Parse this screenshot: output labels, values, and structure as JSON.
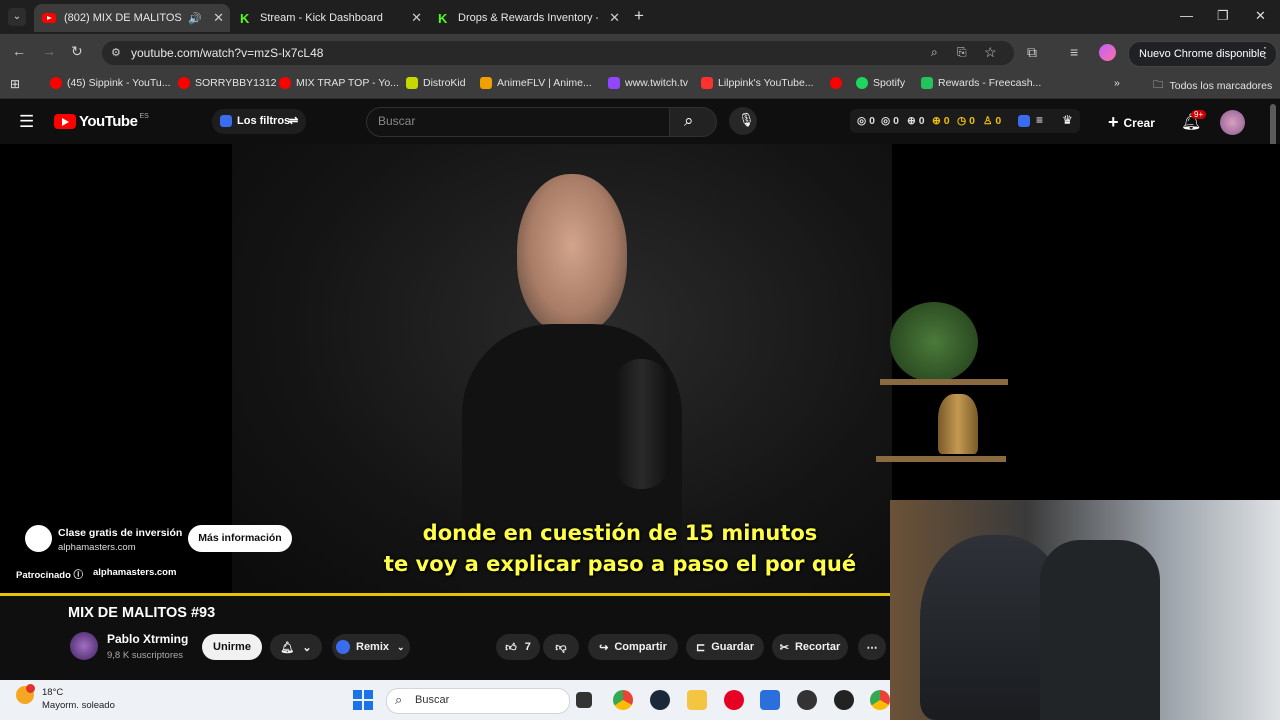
{
  "browser": {
    "tabs": [
      {
        "title": "(802) MIX DE MALITOS #93",
        "active": true,
        "favicon": "youtube-icon"
      },
      {
        "title": "Stream - Kick Dashboard",
        "active": false,
        "favicon": "kick-icon"
      },
      {
        "title": "Drops & Rewards Inventory - Ki",
        "active": false,
        "favicon": "kick-icon"
      }
    ],
    "url": "youtube.com/watch?v=mzS-lx7cL48",
    "chrome_update_label": "Nuevo Chrome disponible",
    "bookmarks": [
      {
        "label": "(45) Sippink - YouTu...",
        "color": "#ff0000"
      },
      {
        "label": "SORRYBBY1312",
        "color": "#ff0000"
      },
      {
        "label": "MIX TRAP TOP - Yo...",
        "color": "#ff0000"
      },
      {
        "label": "DistroKid",
        "color": "#c7d800"
      },
      {
        "label": "AnimeFLV | Anime...",
        "color": "#f0a000"
      },
      {
        "label": "www.twitch.tv",
        "color": "#9146ff"
      },
      {
        "label": "Lilppink's YouTube...",
        "color": "#ff3030"
      },
      {
        "label": "",
        "color": "#ff0000"
      },
      {
        "label": "Spotify",
        "color": "#1ed760"
      },
      {
        "label": "Rewards - Freecash...",
        "color": "#23c45e"
      }
    ],
    "all_bookmarks_label": "Todos los marcadores"
  },
  "youtube": {
    "logo_text": "YouTube",
    "logo_region": "ES",
    "filters_label": "Los filtros",
    "search_placeholder": "Buscar",
    "stats": [
      "0",
      "0",
      "0",
      "0",
      "0",
      "0"
    ],
    "create_label": "Crear",
    "notif_badge": "9+"
  },
  "video": {
    "subtitle_line1": "donde en cuestión de 15 minutos",
    "subtitle_line2": "te voy a explicar paso a paso el por qué",
    "ad": {
      "title": "Clase gratis de inversión",
      "domain": "alphamasters.com",
      "cta": "Más información",
      "sponsored": "Patrocinado",
      "sponsored_domain": "alphamasters.com"
    }
  },
  "details": {
    "title": "MIX DE MALITOS #93",
    "channel": "Pablo Xtrming",
    "subscribers": "9,8 K suscriptores",
    "join_label": "Unirme",
    "remix_label": "Remix",
    "likes": "7",
    "share_label": "Compartir",
    "save_label": "Guardar",
    "clip_label": "Recortar"
  },
  "taskbar": {
    "weather_temp": "18°C",
    "weather_desc": "Mayorm. soleado",
    "search_placeholder": "Buscar"
  }
}
